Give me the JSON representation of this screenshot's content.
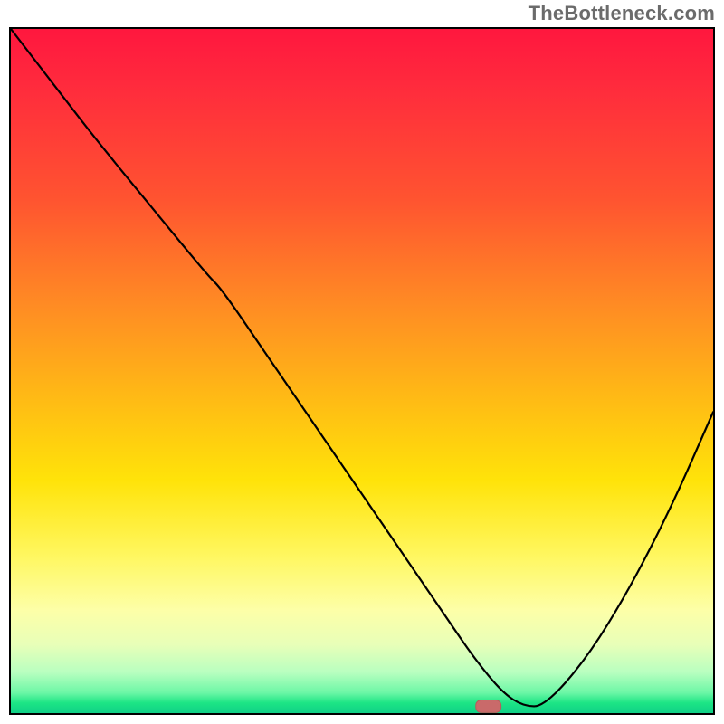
{
  "watermark": "TheBottleneck.com",
  "chart_data": {
    "type": "line",
    "title": "",
    "xlabel": "",
    "ylabel": "",
    "xlim": [
      0,
      100
    ],
    "ylim": [
      0,
      100
    ],
    "grid": false,
    "legend": false,
    "background": "red-yellow-green vertical gradient (bottleneck heat)",
    "series": [
      {
        "name": "bottleneck-curve",
        "x": [
          0,
          6,
          12,
          20,
          28,
          30,
          36,
          44,
          52,
          58,
          62,
          66,
          70,
          73,
          76,
          82,
          88,
          94,
          100
        ],
        "y": [
          100,
          92,
          84,
          74,
          64,
          62,
          53,
          41,
          29,
          20,
          14,
          8,
          3,
          1,
          1,
          8,
          18,
          30,
          44
        ]
      }
    ],
    "marker": {
      "x": 68,
      "y": 1,
      "shape": "pill",
      "color": "#c96a6a"
    },
    "note": "x and y are percentages of the plot area; curve values estimated from pixels relative to the 780×760 plot box."
  }
}
